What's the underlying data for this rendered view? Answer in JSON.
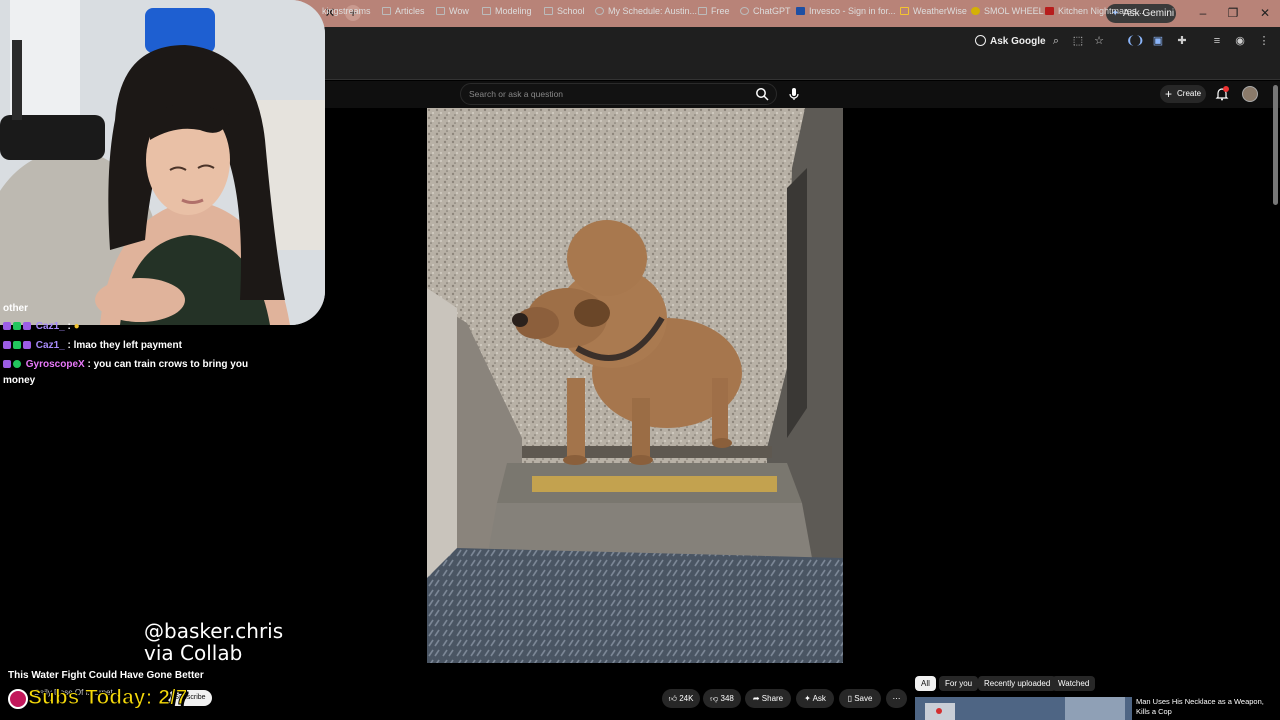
{
  "browser": {
    "ask_gemini": "Ask Gemini",
    "ask_google": "Ask Google",
    "bookmarks": [
      {
        "label": "kingstreams"
      },
      {
        "label": "Articles"
      },
      {
        "label": "Wow"
      },
      {
        "label": "Modeling"
      },
      {
        "label": "School"
      },
      {
        "label": "My Schedule: Austin..."
      },
      {
        "label": "Free"
      },
      {
        "label": "ChatGPT"
      },
      {
        "label": "Invesco - Sign in for..."
      },
      {
        "label": "WeatherWise"
      },
      {
        "label": "SMOL WHEEL"
      },
      {
        "label": "Kitchen Nightmares..."
      }
    ]
  },
  "youtube": {
    "search_placeholder": "Search or ask a question",
    "create_label": "Create",
    "video_title": "This Water Fight Could Have Gone Better",
    "channel_name": "Daily Dose Of Internet",
    "subscribe_label": "Subscribe",
    "actions": {
      "likes": "24K",
      "dislikes": "348",
      "share": "Share",
      "ask": "Ask",
      "save": "Save"
    },
    "chips": [
      "All",
      "For you",
      "Recently uploaded",
      "Watched"
    ],
    "recommended_title": "Man Uses His Necklace as a Weapon, Kills a Cop"
  },
  "stream_overlay": {
    "chat": [
      {
        "user": "",
        "message": "other"
      },
      {
        "user": "Caz1_",
        "message": ":"
      },
      {
        "user": "Caz1_",
        "message": ": lmao they left payment"
      },
      {
        "user": "GyroscopeX",
        "message": ": you can train crows to bring you"
      },
      {
        "user": "",
        "message": "money"
      }
    ],
    "credit_line1": "@basker.chris",
    "credit_line2": "via Collab",
    "subs_today": "Subs Today: 2/7"
  }
}
